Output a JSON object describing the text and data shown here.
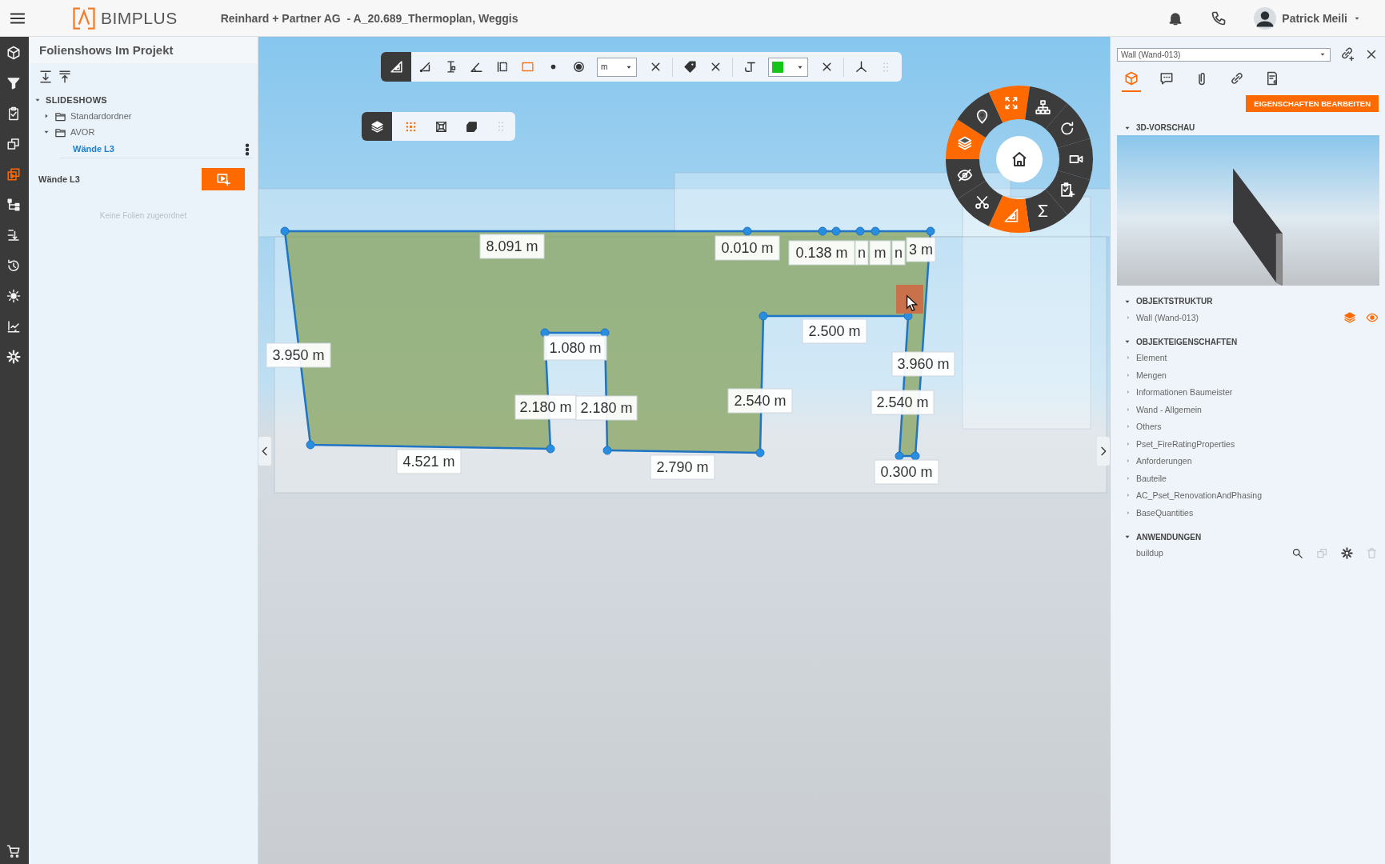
{
  "top_bar": {
    "brand": "BIMPLUS",
    "project_title": "Reinhard + Partner AG  - A_20.689_Thermoplan, Weggis",
    "user_name": "Patrick Meili"
  },
  "nav_rail": [
    {
      "kind": "cube",
      "selected": false
    },
    {
      "kind": "filter",
      "selected": false
    },
    {
      "kind": "clipboard-check",
      "selected": false
    },
    {
      "kind": "copy",
      "selected": false
    },
    {
      "kind": "slideshow",
      "selected": true
    },
    {
      "kind": "tree",
      "selected": false
    },
    {
      "kind": "indent",
      "selected": false
    },
    {
      "kind": "history",
      "selected": false
    },
    {
      "kind": "brightness",
      "selected": false
    },
    {
      "kind": "chart-check",
      "selected": false
    },
    {
      "kind": "gear",
      "selected": false
    }
  ],
  "left_panel": {
    "title": "Folienshows Im Projekt",
    "tree": [
      {
        "label": "SLIDESHOWS",
        "kind": "section",
        "expanded": true,
        "children": [
          {
            "label": "Standardordner",
            "kind": "folder",
            "expanded": false
          },
          {
            "label": "AVOR",
            "kind": "folder",
            "expanded": true,
            "children": [
              {
                "label": "Wände L3",
                "kind": "slideshow",
                "selected": true
              }
            ]
          }
        ]
      }
    ],
    "slideshow_title": "Wände L3",
    "empty_message": "Keine Folien zugeordnet"
  },
  "viewer": {
    "measure_toolbar": [
      {
        "kind": "set-square",
        "selected": true
      },
      {
        "kind": "line",
        "selected": false
      },
      {
        "kind": "vertical-dim",
        "selected": false
      },
      {
        "kind": "angle",
        "selected": false
      },
      {
        "kind": "area-dashed",
        "selected": false
      },
      {
        "kind": "rect-dashed",
        "selected": true
      },
      {
        "kind": "dot",
        "selected": false
      },
      {
        "kind": "radio-dot",
        "selected": false
      },
      {
        "kind": "unit-select",
        "value": "m"
      },
      {
        "kind": "close",
        "selected": false
      },
      {
        "kind": "tag",
        "selected": false
      },
      {
        "kind": "close",
        "selected": false
      },
      {
        "kind": "text-tool",
        "selected": false
      },
      {
        "kind": "color-select",
        "color": "#18c418"
      },
      {
        "kind": "close",
        "selected": false
      },
      {
        "kind": "axes",
        "selected": false
      },
      {
        "kind": "drag-handle"
      }
    ],
    "view_toolbar": [
      {
        "kind": "layers",
        "selected": true
      },
      {
        "kind": "grid-dots",
        "selected": true
      },
      {
        "kind": "wire-cube",
        "selected": false
      },
      {
        "kind": "solid-cube",
        "selected": false
      },
      {
        "kind": "drag-handle"
      }
    ],
    "wheel": [
      {
        "kind": "camera",
        "active": false
      },
      {
        "kind": "clipboard-plus",
        "active": false
      },
      {
        "kind": "sigma",
        "active": false
      },
      {
        "kind": "set-square",
        "active": true
      },
      {
        "kind": "scissors",
        "active": false
      },
      {
        "kind": "eye-slash",
        "active": false
      },
      {
        "kind": "layers",
        "active": true
      },
      {
        "kind": "pin",
        "active": false
      },
      {
        "kind": "fullscreen",
        "active": true
      },
      {
        "kind": "hierarchy",
        "active": false
      },
      {
        "kind": "rotate",
        "active": false
      }
    ],
    "measurements": [
      "8.091 m",
      "0.010 m",
      "0.138 m",
      "n",
      "m",
      "n",
      "3 m",
      "3.950 m",
      "1.080 m",
      "2.500 m",
      "3.960 m",
      "2.180 m",
      "2.180 m",
      "2.540 m",
      "2.540 m",
      "4.521 m",
      "2.790 m",
      "0.300 m"
    ]
  },
  "right_panel": {
    "object_select": "Wall (Wand-013)",
    "tabs": [
      {
        "kind": "cube",
        "selected": true
      },
      {
        "kind": "comment",
        "selected": false
      },
      {
        "kind": "paperclip",
        "selected": false
      },
      {
        "kind": "link",
        "selected": false
      },
      {
        "kind": "document",
        "selected": false
      }
    ],
    "edit_button": "EIGENSCHAFTEN BEARBEITEN",
    "sections": [
      {
        "title": "3D-VORSCHAU",
        "kind": "preview",
        "expanded": true
      },
      {
        "title": "OBJEKTSTRUKTUR",
        "kind": "structure",
        "expanded": true,
        "items": [
          {
            "label": "Wall (Wand-013)",
            "expanded": false
          }
        ]
      },
      {
        "title": "OBJEKTEIGENSCHAFTEN",
        "kind": "properties",
        "expanded": true,
        "items": [
          {
            "label": "Element",
            "expanded": false
          },
          {
            "label": "Mengen",
            "expanded": false
          },
          {
            "label": "Informationen Baumeister",
            "expanded": false
          },
          {
            "label": "Wand - Allgemein",
            "expanded": false
          },
          {
            "label": "Others",
            "expanded": false
          },
          {
            "label": "Pset_FireRatingProperties",
            "expanded": false
          },
          {
            "label": "Anforderungen",
            "expanded": false
          },
          {
            "label": "Bauteile",
            "expanded": false
          },
          {
            "label": "AC_Pset_RenovationAndPhasing",
            "expanded": false
          },
          {
            "label": "BaseQuantities",
            "expanded": false
          }
        ]
      },
      {
        "title": "ANWENDUNGEN",
        "kind": "apps",
        "expanded": true,
        "items": [
          {
            "label": "buildup",
            "actions": [
              {
                "kind": "search",
                "disabled": false
              },
              {
                "kind": "copy",
                "disabled": true
              },
              {
                "kind": "gear",
                "disabled": false
              },
              {
                "kind": "trash",
                "disabled": true
              }
            ]
          }
        ]
      }
    ]
  }
}
